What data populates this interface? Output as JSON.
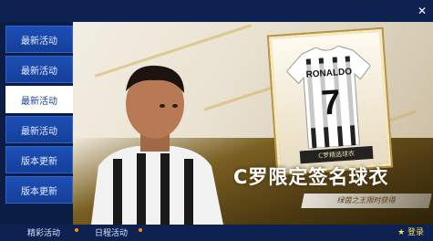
{
  "window": {
    "close_glyph": "✕"
  },
  "sidebar": {
    "items": [
      {
        "label": "最新活动",
        "active": false
      },
      {
        "label": "最新活动",
        "active": false
      },
      {
        "label": "最新活动",
        "active": true
      },
      {
        "label": "最新活动",
        "active": false
      },
      {
        "label": "版本更新",
        "active": false
      },
      {
        "label": "版本更新",
        "active": false
      }
    ]
  },
  "banner": {
    "jersey_name": "RONALDO",
    "jersey_number": "7",
    "card_label": "C罗精选球衣",
    "title": "C罗限定签名球衣",
    "subtitle": "绿茵之王限时获得"
  },
  "bottom": {
    "tabs": [
      {
        "label": "精彩活动"
      },
      {
        "label": "日程活动"
      }
    ],
    "login_label": "★ 登录"
  },
  "colors": {
    "accent": "#1d4fb6",
    "active": "#ffffff",
    "gold": "#b89344"
  }
}
